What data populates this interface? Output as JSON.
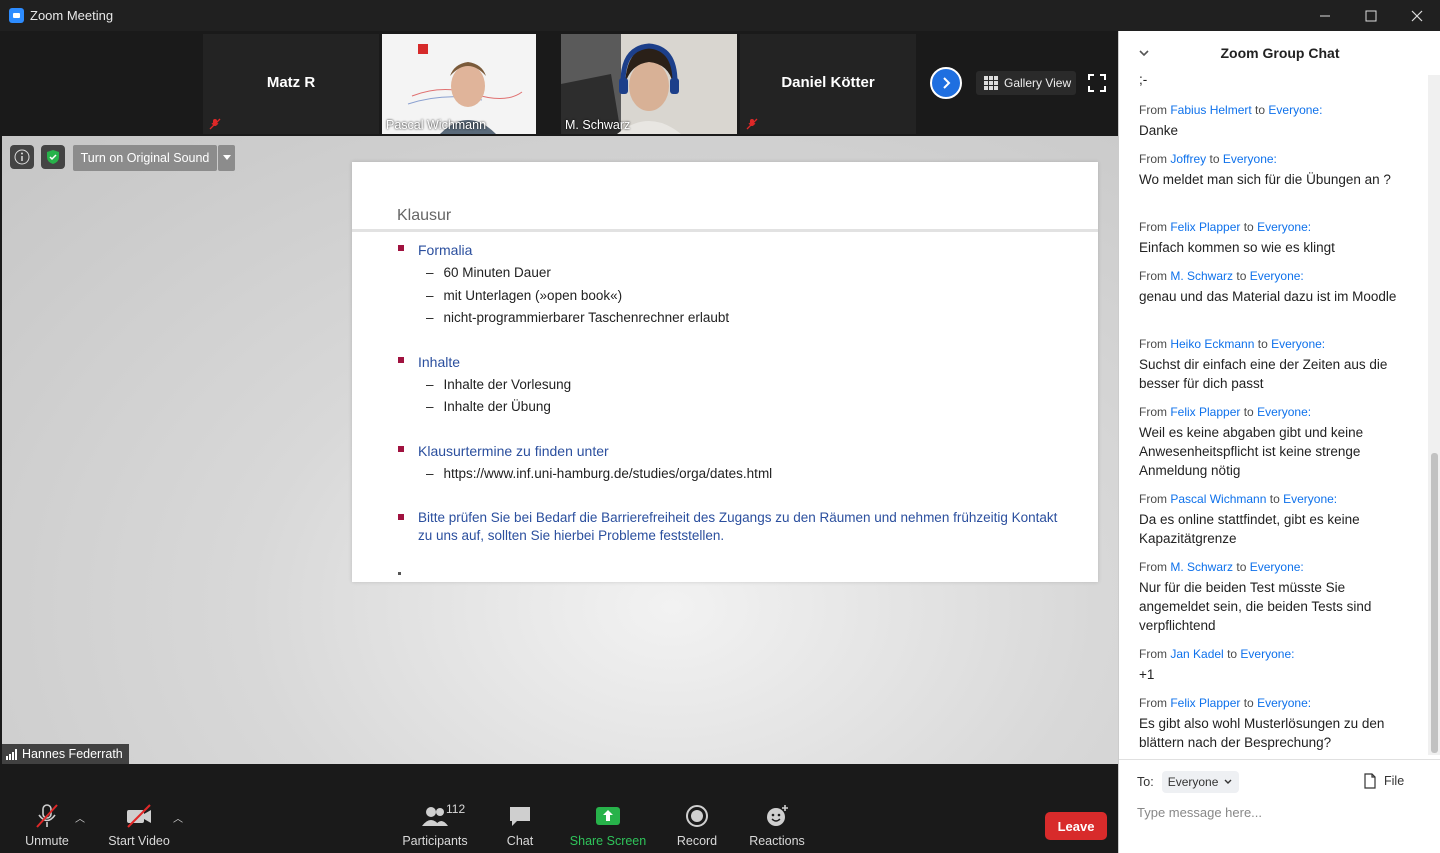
{
  "window": {
    "title": "Zoom Meeting"
  },
  "strip": {
    "tiles": [
      {
        "name": "Matz R"
      },
      {
        "name": "Pascal Wichmann"
      },
      {
        "name": "M. Schwarz"
      },
      {
        "name": "Daniel Kötter"
      }
    ],
    "gallery_view_label": "Gallery View"
  },
  "share": {
    "original_sound_label": "Turn on Original Sound",
    "speaker_name": "Hannes Federrath",
    "slide": {
      "title": "Klausur",
      "sections": [
        {
          "heading": "Formalia",
          "items": [
            "60 Minuten Dauer",
            "mit Unterlagen (»open book«)",
            "nicht-programmierbarer Taschenrechner erlaubt"
          ]
        },
        {
          "heading": "Inhalte",
          "items": [
            "Inhalte der Vorlesung",
            "Inhalte der Übung"
          ]
        },
        {
          "heading": "Klausurtermine zu finden unter",
          "items": [
            "https://www.inf.uni-hamburg.de/studies/orga/dates.html"
          ]
        },
        {
          "heading": "Bitte prüfen Sie bei Bedarf die Barrierefreiheit des Zugangs zu den Räumen und nehmen frühzeitig Kontakt zu uns auf, sollten Sie hierbei Probleme feststellen.",
          "items": []
        }
      ]
    }
  },
  "toolbar": {
    "unmute": "Unmute",
    "start_video": "Start Video",
    "participants": "Participants",
    "participants_count": "112",
    "chat": "Chat",
    "share_screen": "Share Screen",
    "record": "Record",
    "reactions": "Reactions",
    "leave": "Leave"
  },
  "chat": {
    "title": "Zoom Group Chat",
    "truncated_line": ";-",
    "messages": [
      {
        "from": "Fabius Helmert",
        "to": "Everyone:",
        "text": "Danke"
      },
      {
        "from": "Joffrey",
        "to": "Everyone:",
        "text": "Wo meldet man sich für die Übungen an ?"
      },
      {
        "from": "Felix Plapper",
        "to": "Everyone:",
        "text": "Einfach kommen so wie es klingt"
      },
      {
        "from": "M. Schwarz",
        "to": "Everyone:",
        "text": "genau und das Material dazu ist im Moodle"
      },
      {
        "from": "Heiko Eckmann",
        "to": "Everyone:",
        "text": "Suchst dir einfach eine der Zeiten aus die besser für dich passt"
      },
      {
        "from": "Felix Plapper",
        "to": "Everyone:",
        "text": "Weil es keine abgaben gibt und keine Anwesenheitspflicht ist keine strenge Anmeldung nötig"
      },
      {
        "from": "Pascal Wichmann",
        "to": "Everyone:",
        "text": "Da es online stattfindet, gibt es keine Kapazitätgrenze"
      },
      {
        "from": "M. Schwarz",
        "to": "Everyone:",
        "text": "Nur für die beiden Test müsste Sie angemeldet sein, die beiden Tests sind verpflichtend"
      },
      {
        "from": "Jan Kadel",
        "to": "Everyone:",
        "text": "+1"
      },
      {
        "from": "Felix Plapper",
        "to": "Everyone:",
        "text": "Es gibt also wohl Musterlösungen zu den blättern nach der Besprechung?"
      }
    ],
    "from_word": "From",
    "to_word": "to",
    "to_label": "To:",
    "recipient": "Everyone",
    "file_label": "File",
    "input_placeholder": "Type message here..."
  }
}
